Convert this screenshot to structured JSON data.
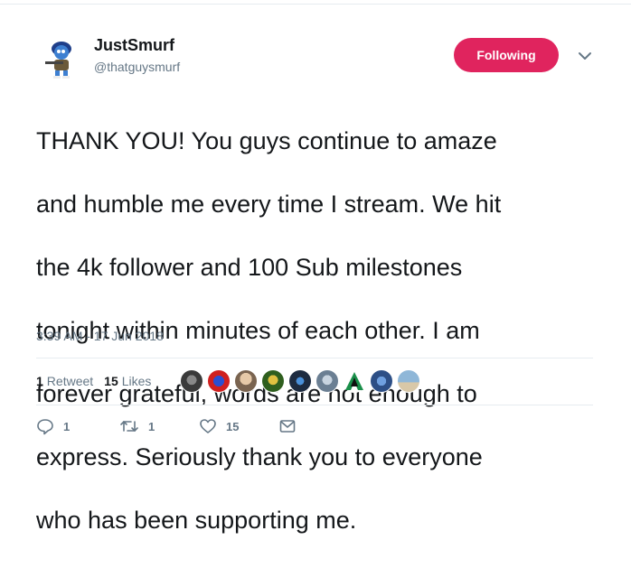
{
  "author": {
    "display_name": "JustSmurf",
    "handle": "@thatguysmurf"
  },
  "follow_button": {
    "label": "Following",
    "color": "#e0245e"
  },
  "tweet": {
    "text_lines": [
      "THANK YOU!  You guys continue to amaze",
      "and humble me every time I stream.  We hit",
      "the 4k follower and 100 Sub milestones",
      "tonight within minutes of each other. I am",
      "forever grateful, words are not enough to",
      "express.  Seriously thank you to everyone",
      "who has been supporting me."
    ],
    "timestamp": "3:39 AM - 17 Jun 2018"
  },
  "stats": {
    "retweets_count": "1",
    "retweets_label": "Retweet",
    "likes_count": "15",
    "likes_label": "Likes"
  },
  "likers": [
    {
      "icon": "liker-avatar-1",
      "color": "#3a3a3a"
    },
    {
      "icon": "liker-avatar-2",
      "color": "#d0201f"
    },
    {
      "icon": "liker-avatar-3",
      "color": "#c9a27a"
    },
    {
      "icon": "liker-avatar-4",
      "color": "#2f5f1e"
    },
    {
      "icon": "liker-avatar-5",
      "color": "#1d2b40"
    },
    {
      "icon": "liker-avatar-6",
      "color": "#6b7f93"
    },
    {
      "icon": "liker-avatar-7",
      "color": "#1a8f4a"
    },
    {
      "icon": "liker-avatar-8",
      "color": "#2d4f86"
    },
    {
      "icon": "liker-avatar-9",
      "color": "#8fb7d8"
    }
  ],
  "actions": {
    "reply_count": "1",
    "retweet_count": "1",
    "like_count": "15"
  },
  "icons": {
    "reply": "reply-icon",
    "retweet": "retweet-icon",
    "like": "heart-icon",
    "dm": "envelope-icon",
    "menu": "chevron-down-icon"
  },
  "colors": {
    "secondary_text": "#657786",
    "primary_text": "#14171a"
  }
}
